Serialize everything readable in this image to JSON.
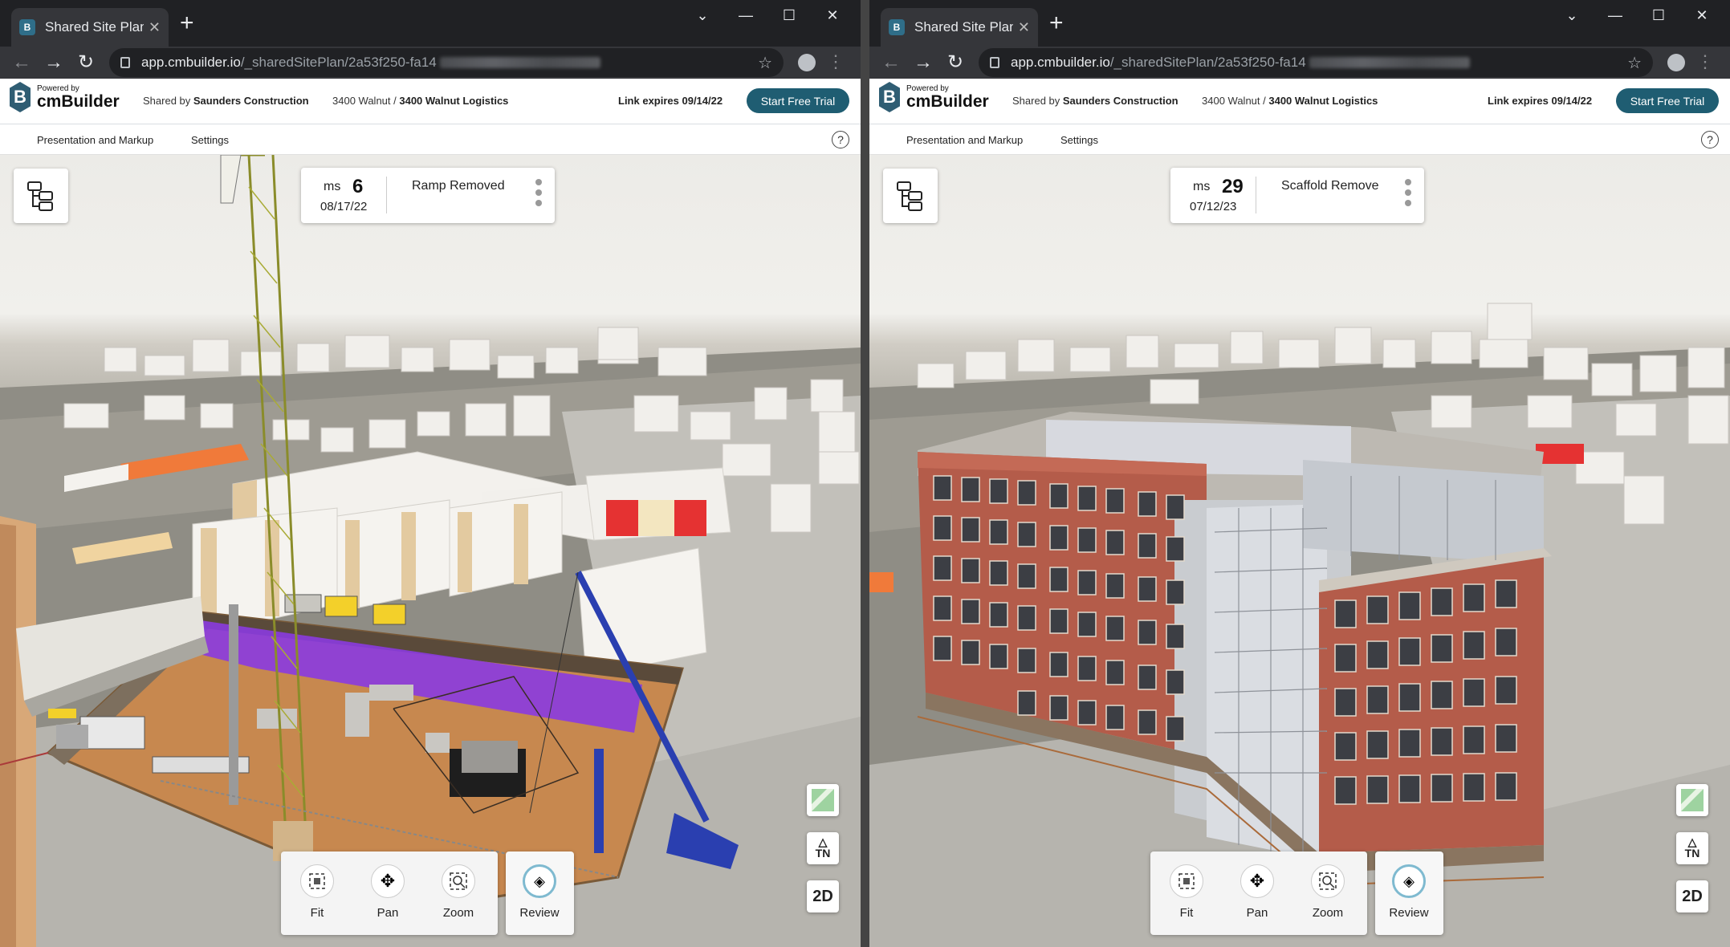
{
  "windows": [
    {
      "tab_title": "Shared Site Plans -",
      "url_host": "app.cmbuilder.io",
      "url_path": "/_sharedSitePlan/2a53f250-fa14",
      "header": {
        "powered_by": "Powered by",
        "brand": "cmBuilder",
        "shared_by_prefix": "Shared by",
        "shared_by_company": "Saunders Construction",
        "project": "3400 Walnut /",
        "plan": "3400 Walnut Logistics",
        "expires": "Link expires 09/14/22",
        "trial_button": "Start Free Trial"
      },
      "menu": {
        "presentation": "Presentation and Markup",
        "settings": "Settings",
        "help": "?"
      },
      "milestone": {
        "ms_label": "ms",
        "number": "6",
        "date": "08/17/22",
        "name": "Ramp Removed"
      },
      "side_buttons": {
        "north": "TN",
        "mode": "2D"
      },
      "tools": {
        "fit": "Fit",
        "pan": "Pan",
        "zoom": "Zoom",
        "review": "Review"
      }
    },
    {
      "tab_title": "Shared Site Plans -",
      "url_host": "app.cmbuilder.io",
      "url_path": "/_sharedSitePlan/2a53f250-fa14",
      "header": {
        "powered_by": "Powered by",
        "brand": "cmBuilder",
        "shared_by_prefix": "Shared by",
        "shared_by_company": "Saunders Construction",
        "project": "3400 Walnut /",
        "plan": "3400 Walnut Logistics",
        "expires": "Link expires 09/14/22",
        "trial_button": "Start Free Trial"
      },
      "menu": {
        "presentation": "Presentation and Markup",
        "settings": "Settings",
        "help": "?"
      },
      "milestone": {
        "ms_label": "ms",
        "number": "29",
        "date": "07/12/23",
        "name": "Scaffold Remove"
      },
      "side_buttons": {
        "north": "TN",
        "mode": "2D"
      },
      "tools": {
        "fit": "Fit",
        "pan": "Pan",
        "zoom": "Zoom",
        "review": "Review"
      }
    }
  ],
  "colors": {
    "brand": "#1f5d72",
    "chrome_dark": "#202124",
    "chrome_mid": "#35363a",
    "brick": "#b05a48",
    "crane": "#8a8c2a",
    "purple": "#8a3be0",
    "crane_blue": "#2a3fb0"
  },
  "icons": [
    "hierarchy-icon",
    "map-thumbnail-icon",
    "north-arrow-icon",
    "fit-icon",
    "pan-icon",
    "zoom-icon",
    "review-icon",
    "lock-icon",
    "star-icon",
    "profile-icon"
  ]
}
